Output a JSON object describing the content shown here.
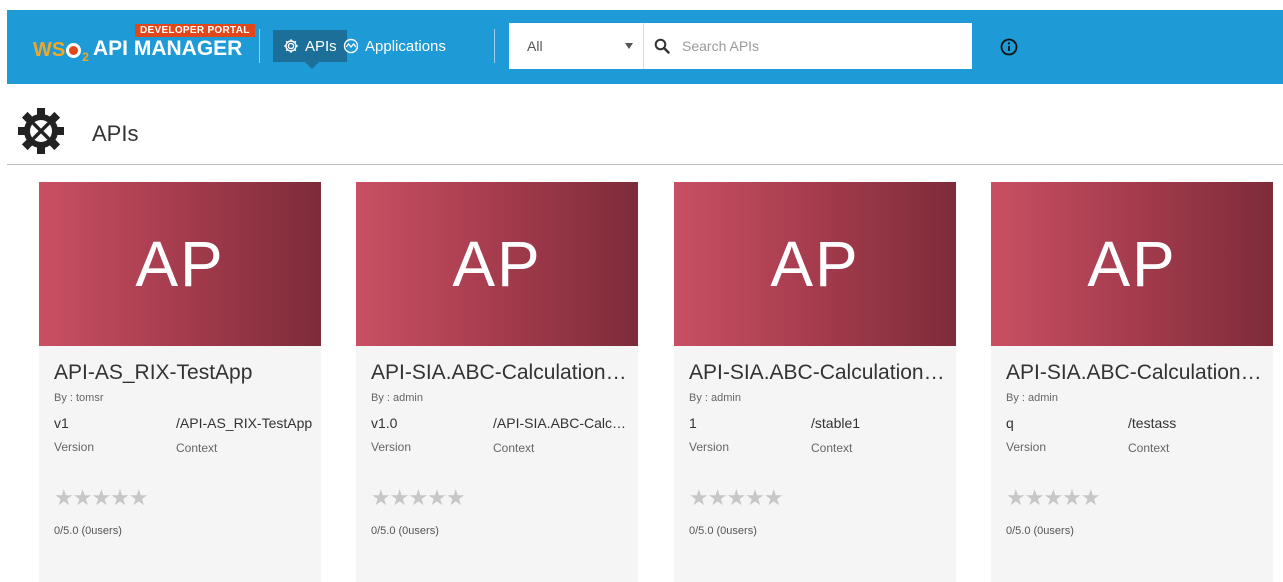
{
  "header": {
    "portal_badge": "DEVELOPER PORTAL",
    "brand_wso": "WS",
    "brand_two": "2",
    "brand_product": "API MANAGER",
    "nav_apis": "APIs",
    "nav_applications": "Applications",
    "search_scope": "All",
    "search_placeholder": "Search APIs",
    "colors": {
      "bar": "#1e9ad6",
      "active_tab": "#1b6f98",
      "badge": "#e0471b"
    }
  },
  "page": {
    "title": "APIs"
  },
  "cards": [
    {
      "thumb": "AP",
      "name": "API-AS_RIX-TestApp",
      "by": "By : tomsr",
      "version": "v1",
      "context": "/API-AS_RIX-TestApp",
      "version_label": "Version",
      "context_label": "Context",
      "stars": "★★★★★",
      "rating": "0/5.0 (0users)"
    },
    {
      "thumb": "AP",
      "name": "API-SIA.ABC-CalculationService",
      "by": "By : admin",
      "version": "v1.0",
      "context": "/API-SIA.ABC-CalculationService",
      "version_label": "Version",
      "context_label": "Context",
      "stars": "★★★★★",
      "rating": "0/5.0 (0users)"
    },
    {
      "thumb": "AP",
      "name": "API-SIA.ABC-CalculationService",
      "by": "By : admin",
      "version": "1",
      "context": "/stable1",
      "version_label": "Version",
      "context_label": "Context",
      "stars": "★★★★★",
      "rating": "0/5.0 (0users)"
    },
    {
      "thumb": "AP",
      "name": "API-SIA.ABC-CalculationService",
      "by": "By : admin",
      "version": "q",
      "context": "/testass",
      "version_label": "Version",
      "context_label": "Context",
      "stars": "★★★★★",
      "rating": "0/5.0 (0users)"
    }
  ]
}
